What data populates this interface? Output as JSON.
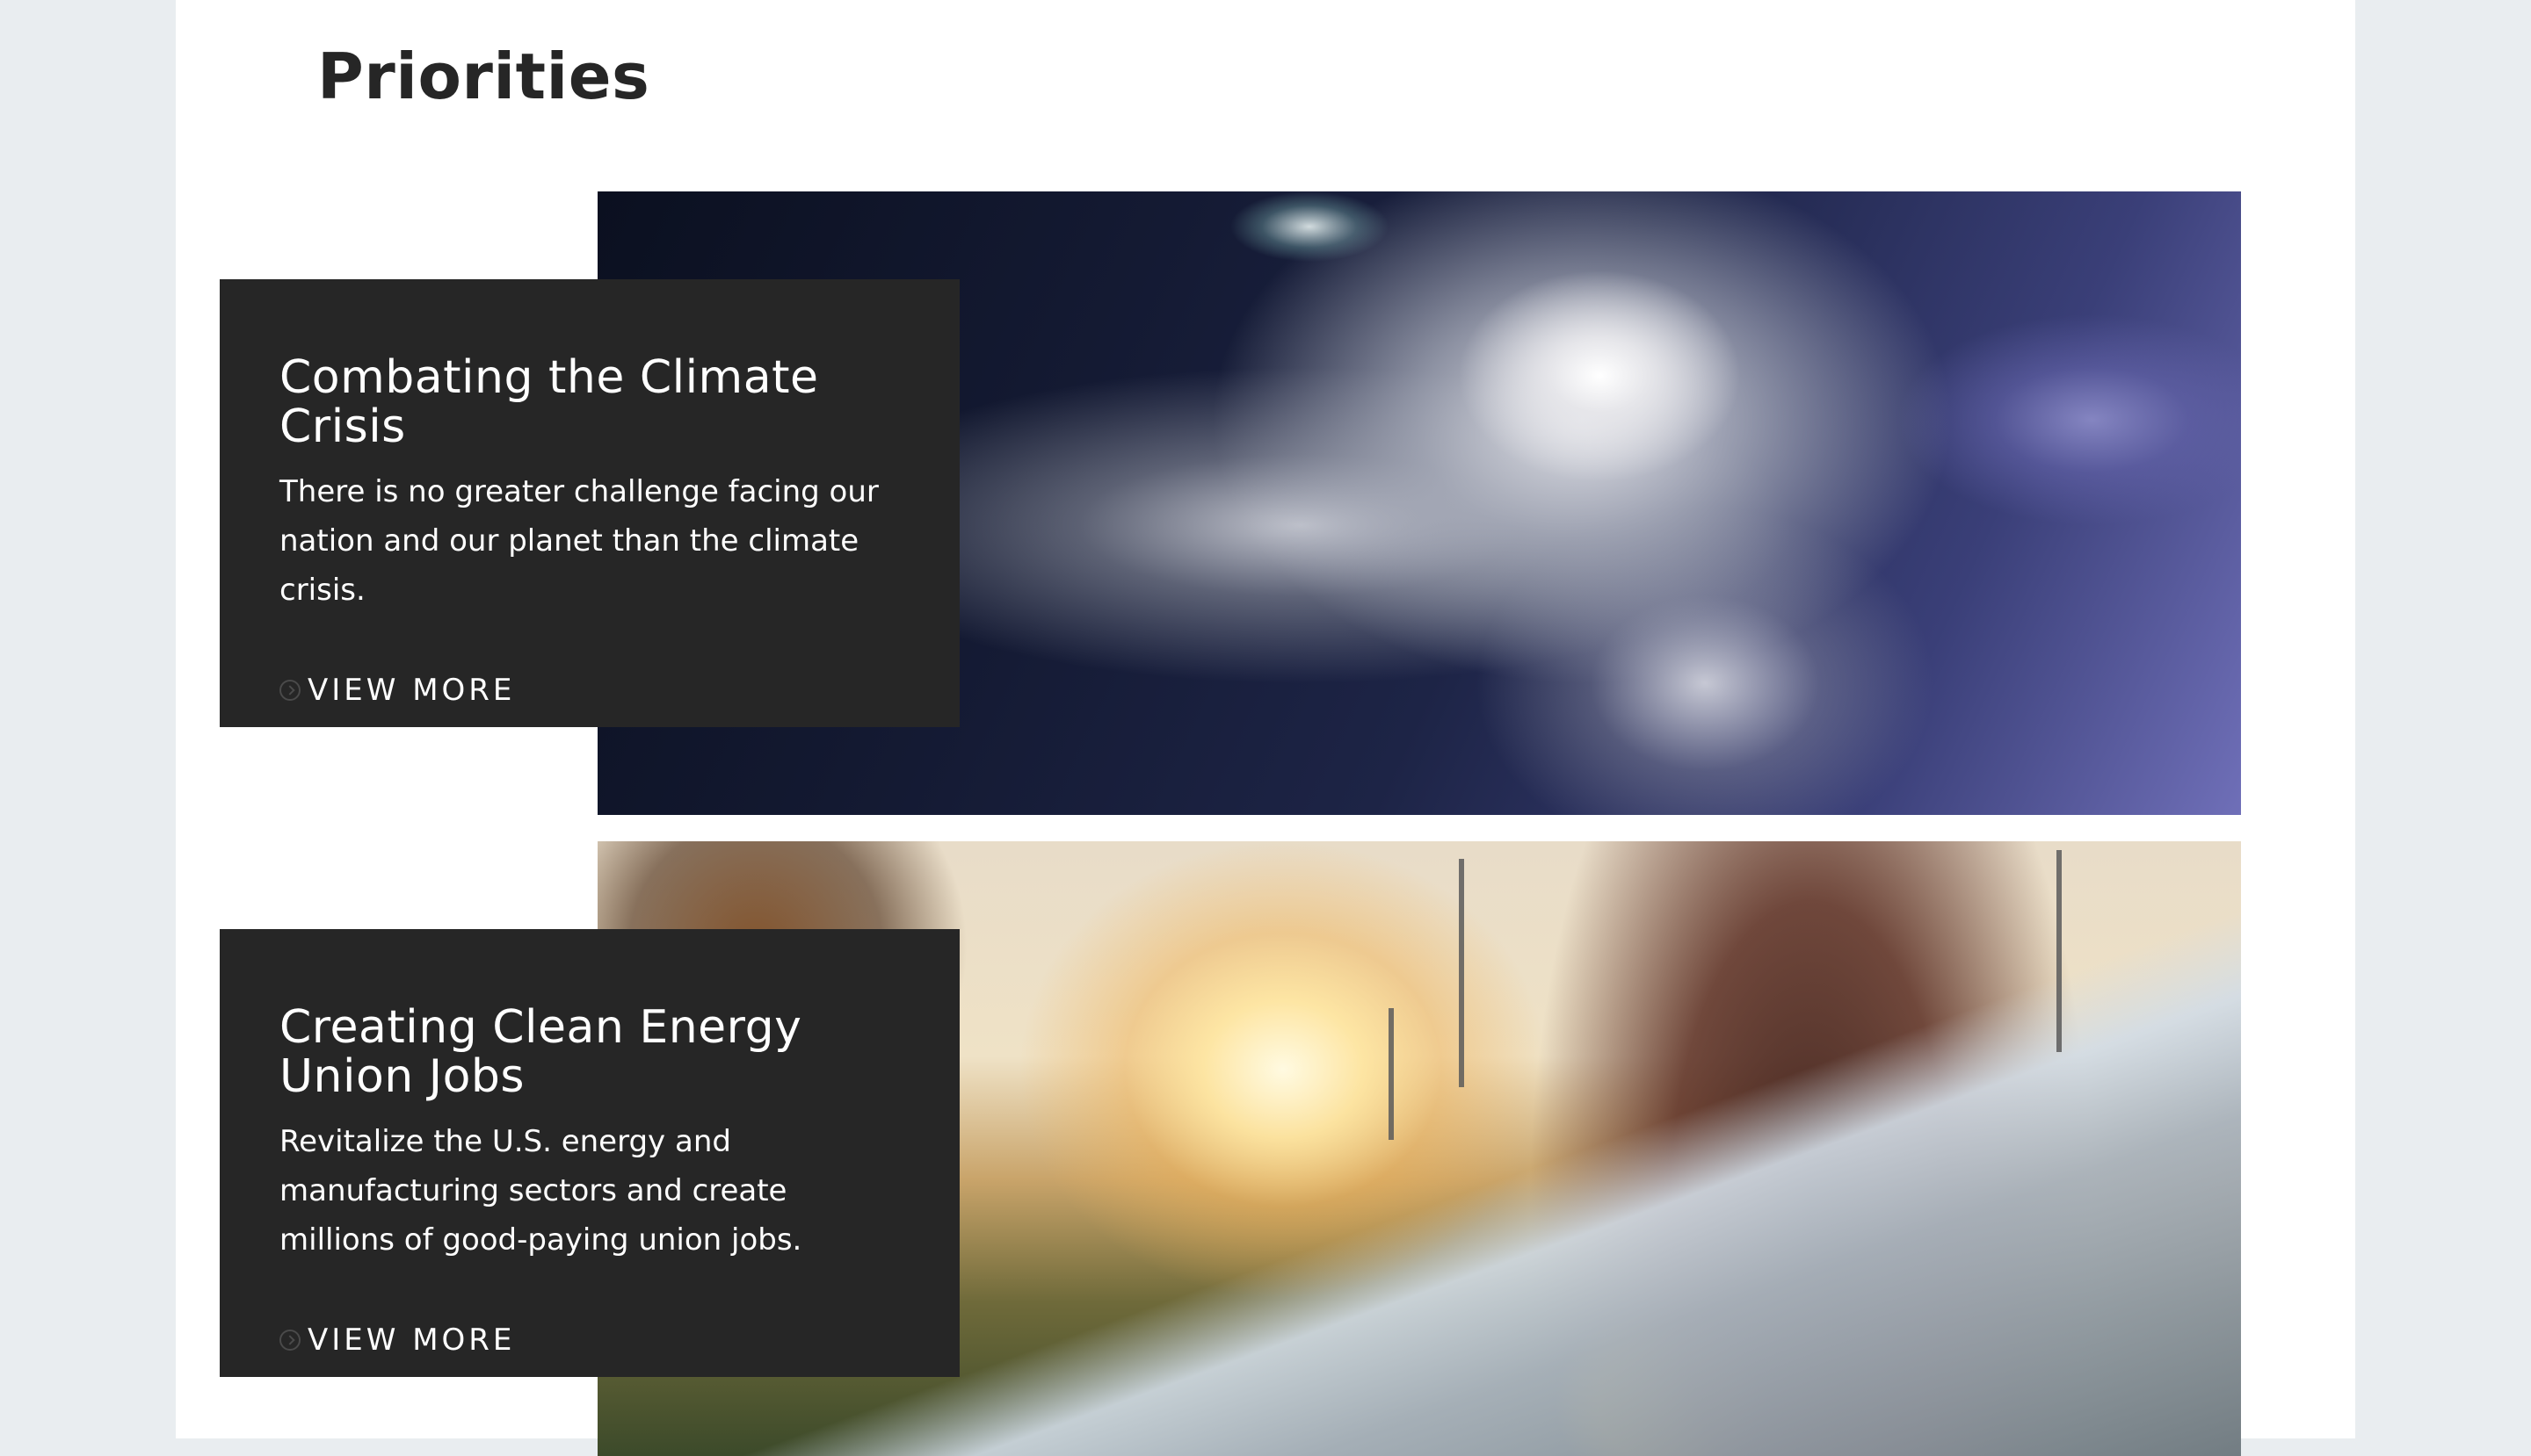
{
  "page": {
    "title": "Priorities"
  },
  "cards": [
    {
      "title": "Combating the Climate Crisis",
      "text": "There is no greater challenge facing our nation and our planet than the climate crisis.",
      "link_label": "VIEW MORE",
      "image": "hurricane-satellite-image"
    },
    {
      "title": "Creating Clean Energy Union Jobs",
      "text": "Revitalize the U.S. energy and manufacturing sectors and create millions of good-paying union jobs.",
      "link_label": "VIEW MORE",
      "image": "clean-energy-workers-image"
    }
  ],
  "colors": {
    "background": "#e9edf0",
    "page": "#ffffff",
    "card": "#262626",
    "heading": "#262626",
    "card_text": "#ffffff"
  },
  "icons": {
    "view_more": "chevron-right-circle-icon"
  }
}
